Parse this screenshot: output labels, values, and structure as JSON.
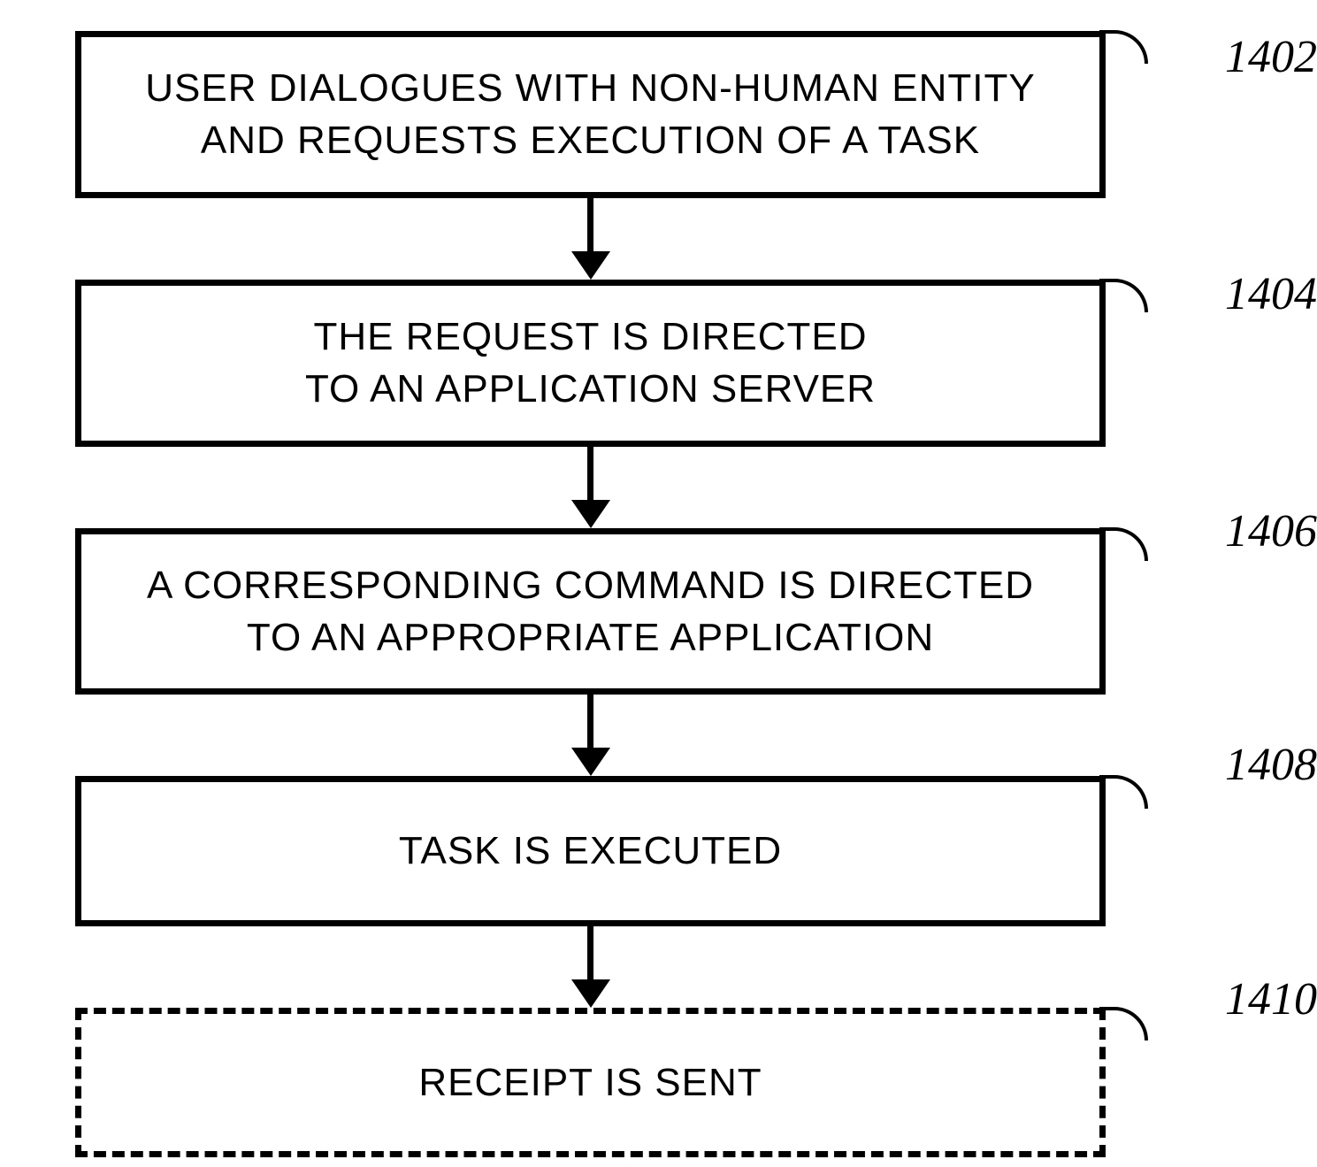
{
  "steps": [
    {
      "text": "USER DIALOGUES WITH NON-HUMAN ENTITY\nAND REQUESTS EXECUTION OF A TASK",
      "label": "1402",
      "dashed": false,
      "twoLine": true
    },
    {
      "text": "THE REQUEST IS DIRECTED\nTO AN APPLICATION SERVER",
      "label": "1404",
      "dashed": false,
      "twoLine": true
    },
    {
      "text": "A CORRESPONDING COMMAND IS DIRECTED\nTO AN APPROPRIATE APPLICATION",
      "label": "1406",
      "dashed": false,
      "twoLine": true
    },
    {
      "text": "TASK IS EXECUTED",
      "label": "1408",
      "dashed": false,
      "twoLine": false
    },
    {
      "text": "RECEIPT IS SENT",
      "label": "1410",
      "dashed": true,
      "twoLine": false
    }
  ]
}
